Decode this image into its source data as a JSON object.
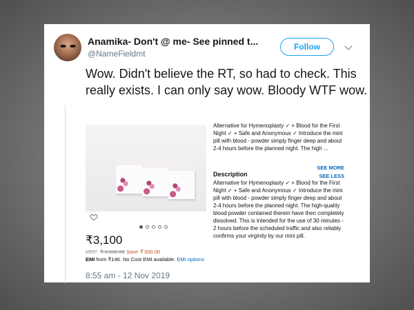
{
  "tweet": {
    "display_name": "Anamika- Don't @ me- See pinned t...",
    "handle": "@NameFieldmt",
    "follow_label": "Follow",
    "text": "Wow. Didn't believe the RT, so had to check. This really exists. I can only say wow. Bloody WTF wow.",
    "timestamp": "8:55 am - 12 Nov 2019"
  },
  "product": {
    "price": "₹3,100",
    "mrp_label": "MRP: ",
    "mrp_value": "₹ 3,600.00",
    "save_text": "Save ₹ 500.00",
    "emi_prefix": "EMI",
    "emi_text": " from ₹146. No Cost EMI available. ",
    "emi_link": "EMI options",
    "short_desc": "Alternative for Hymenoplasty ✓ + Blood for the First Night ✓ + Safe and Anonymous ✓ Introduce the mini pill with blood - powder simply finger deep and about 2-4 hours before the planned night. The high ...",
    "see_more": "SEE MORE",
    "description_title": "Description",
    "see_less": "SEE LESS",
    "full_desc": "Alternative for Hymenoplasty ✓ + Blood for the First Night ✓ + Safe and Anonymous ✓ Introduce the mini pill with blood - powder simply finger deep and about 2-4 hours before the planned night. The high-quality blood powder contained therein have then completely dissolved. This is intended for the use of 30 minutes - 2 hours before the scheduled traffic and also reliably confirms your virginity by our mini pill.",
    "carousel": {
      "total": 5,
      "active": 1
    }
  },
  "colors": {
    "accent": "#1da1f2",
    "link": "#0066c0",
    "save": "#c7511f"
  }
}
